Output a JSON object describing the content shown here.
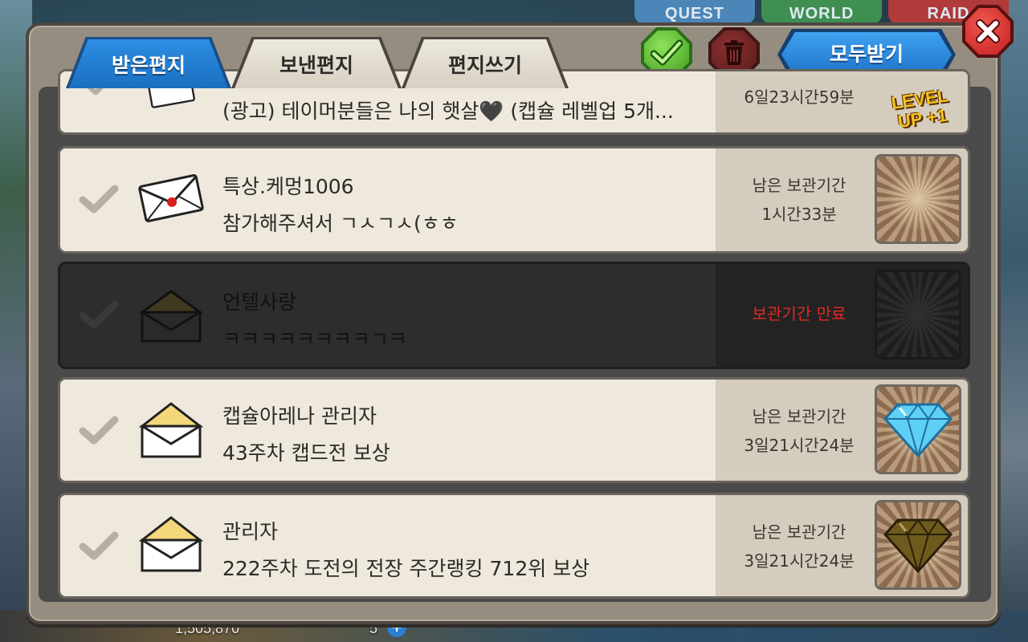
{
  "background": {
    "top_tabs": [
      "QUEST",
      "WORLD",
      "RAID"
    ],
    "gold": "1,505,870",
    "gems": "5"
  },
  "tabs": [
    {
      "label": "받은편지",
      "active": true
    },
    {
      "label": "보낸편지",
      "active": false
    },
    {
      "label": "편지쓰기",
      "active": false
    }
  ],
  "actions": {
    "receive_all_label": "모두받기"
  },
  "mails": [
    {
      "sender": "",
      "message": "(광고) 테이머분들은 나의 햇살🖤 (캡슐 레벨업 5개...",
      "status_label": "",
      "status_time": "6일23시간59분",
      "reward": "level-up-ticket",
      "reward_text": "LEVEL UP +1",
      "expired": false
    },
    {
      "sender": "특상.케멍1006",
      "message": "참가해주셔서 ㄱㅅㄱㅅ(ㅎㅎ",
      "status_label": "남은 보관기간",
      "status_time": "1시간33분",
      "reward": "none",
      "expired": false
    },
    {
      "sender": "언텔사랑",
      "message": "ㅋㅋㅋㅋㅋㅋㅋㅋㄱㅋ",
      "status_label": "보관기간 만료",
      "status_time": "",
      "reward": "none",
      "expired": true
    },
    {
      "sender": "캡슐아레나 관리자",
      "message": "43주차 캡드전 보상",
      "status_label": "남은 보관기간",
      "status_time": "3일21시간24분",
      "reward": "blue-diamond",
      "expired": false
    },
    {
      "sender": "관리자",
      "message": "222주차 도전의 전장 주간랭킹 712위 보상",
      "status_label": "남은 보관기간",
      "status_time": "3일21시간24분",
      "reward": "bronze-diamond",
      "expired": false
    }
  ],
  "colors": {
    "tab_active": "#1b6fc0",
    "expired_text": "#e02a22",
    "confirm_green": "#3f9b22",
    "delete_red": "#5a1a1a",
    "close_red": "#c42020"
  }
}
